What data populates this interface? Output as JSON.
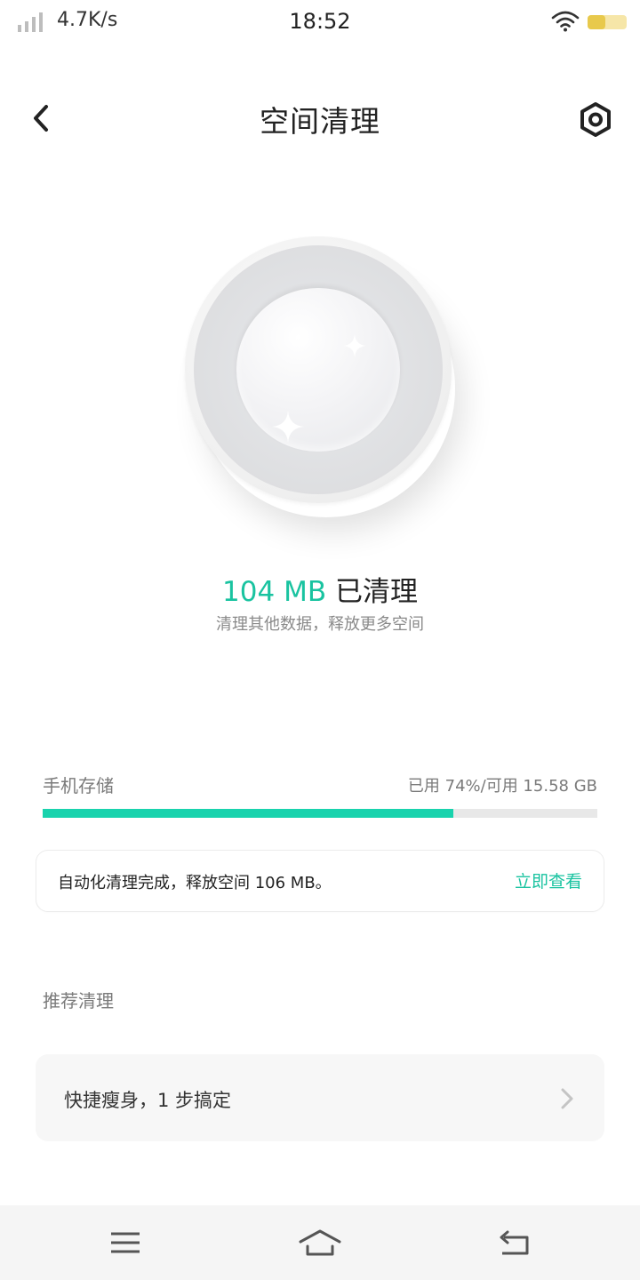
{
  "status_bar": {
    "net_speed": "4.7K/s",
    "time": "18:52",
    "icons": [
      "signal-icon",
      "wifi-icon",
      "battery-icon"
    ]
  },
  "header": {
    "title": "空间清理",
    "back_icon": "chevron-left-icon",
    "settings_icon": "hexagon-gear-icon"
  },
  "result": {
    "amount": "104 MB",
    "label": " 已清理",
    "subtitle": "清理其他数据，释放更多空间"
  },
  "storage": {
    "label": "手机存储",
    "usage_text": "已用 74%/可用 15.58 GB",
    "used_fraction": 0.74
  },
  "notice": {
    "text": "自动化清理完成，释放空间 106 MB。",
    "action_label": "立即查看"
  },
  "recommend": {
    "section_label": "推荐清理",
    "items": [
      {
        "label": "快捷瘦身，1 步搞定"
      }
    ]
  },
  "nav_bar": {
    "icons": [
      "menu-icon",
      "home-icon",
      "back-icon"
    ]
  },
  "colors": {
    "accent": "#19c3a0",
    "bar_fill": "#19d3ad",
    "battery": "#f2d87a"
  }
}
